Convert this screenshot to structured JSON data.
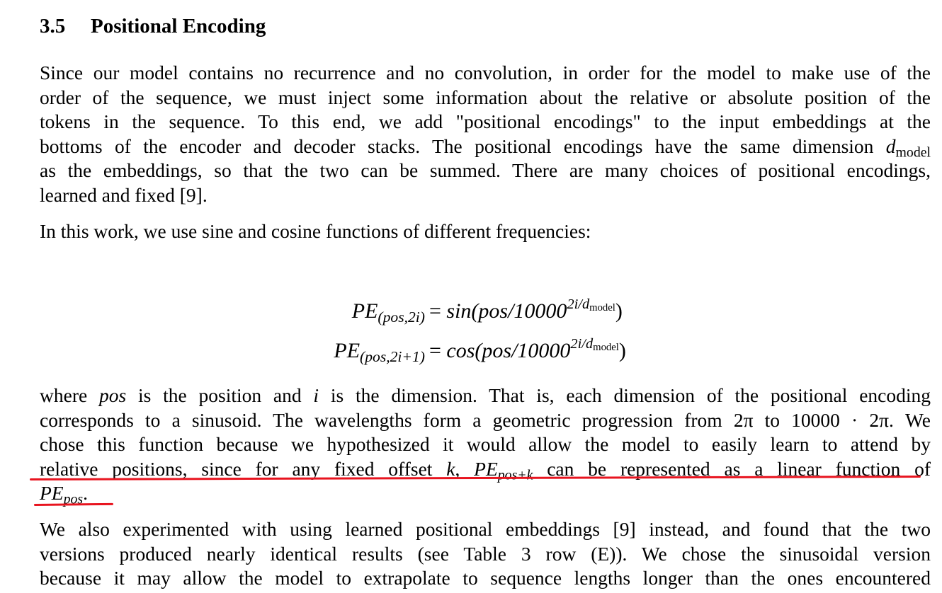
{
  "section": {
    "number": "3.5",
    "title": "Positional Encoding"
  },
  "paragraph1": {
    "l1": "Since our model contains no recurrence and no convolution, in order for the model to make use of the",
    "l2": "order of the sequence, we must inject some information about the relative or absolute position of the",
    "l3": "tokens in the sequence. To this end, we add \"positional encodings\" to the input embeddings at the",
    "l4a": "bottoms of the encoder and decoder stacks. The positional encodings have the same dimension ",
    "l4_d": "d",
    "l4_model": "model",
    "l5": "as the embeddings, so that the two can be summed. There are many choices of positional encodings,",
    "l6": "learned and fixed [9]."
  },
  "paragraph2": {
    "text": "In this work, we use sine and cosine functions of different frequencies:"
  },
  "equations": [
    {
      "lhs_pe": "PE",
      "lhs_sub": "(pos,2i)",
      "rhs_eq": "=",
      "rhs_func": "sin(pos/10000",
      "rhs_exp_a": "2i/d",
      "rhs_exp_b": "model",
      "rhs_close": ")"
    },
    {
      "lhs_pe": "PE",
      "lhs_sub": "(pos,2i+1)",
      "rhs_eq": "=",
      "rhs_func": "cos(pos/10000",
      "rhs_exp_a": "2i/d",
      "rhs_exp_b": "model",
      "rhs_close": ")"
    }
  ],
  "paragraph3": {
    "l1a": "where ",
    "l1_pos": "pos",
    "l1b": " is the position and ",
    "l1_i": "i",
    "l1c": " is the dimension. That is, each dimension of the positional encoding",
    "l2a": "corresponds to a sinusoid. The wavelengths form a geometric progression from ",
    "l2_2pi": "2π",
    "l2b": " to ",
    "l2_big": "10000 · 2π",
    "l2c": ". We",
    "l3": "chose this function because we hypothesized it would allow the model to easily learn to attend by",
    "l4a": "relative positions, since for any fixed offset ",
    "l4_k": "k",
    "l4b": ", ",
    "l4_pe": "PE",
    "l4_sub": "pos+k",
    "l4c": " can be represented as a linear function of",
    "l5_pe": "PE",
    "l5_sub": "pos",
    "l5_end": "."
  },
  "paragraph4": {
    "l1": "We also experimented with using learned positional embeddings [9] instead, and found that the two",
    "l2": "versions produced nearly identical results (see Table 3 row (E)). We chose the sinusoidal version",
    "l3": "because it may allow the model to extrapolate to sequence lengths longer than the ones encountered"
  },
  "annotation": {
    "color": "#e8141f"
  }
}
